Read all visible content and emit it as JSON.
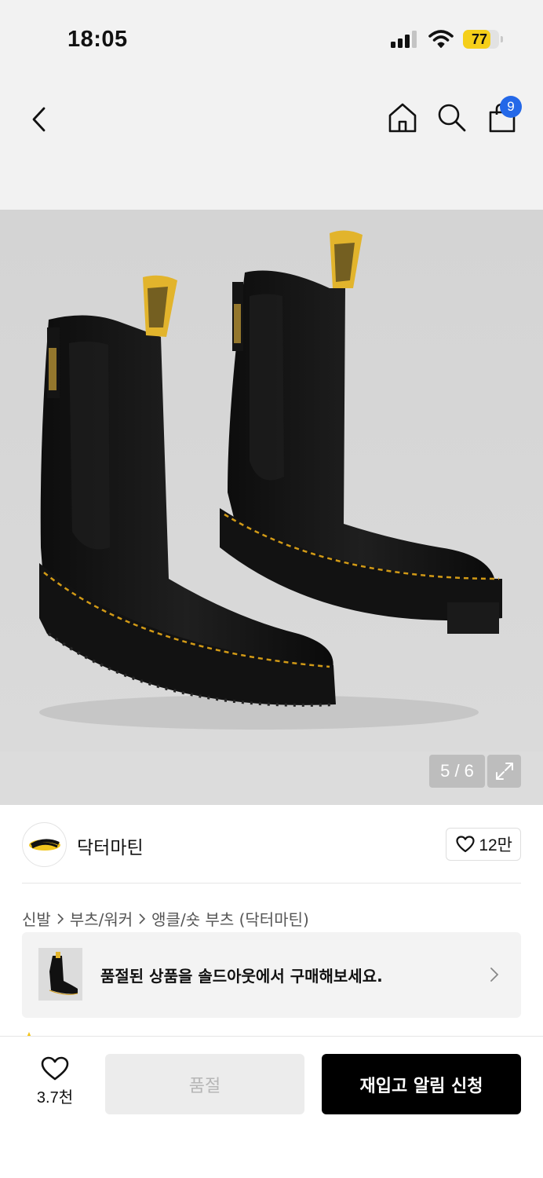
{
  "status_bar": {
    "time": "18:05",
    "battery_percent": "77",
    "battery_level": 0.77
  },
  "nav": {
    "cart_count": "9",
    "icons": [
      "chevron-left-icon",
      "home-icon",
      "search-icon",
      "shopping-bag-icon"
    ]
  },
  "gallery": {
    "page_indicator": "5 / 6",
    "current_index": 5,
    "total": 6,
    "image_subject": "black chelsea boots pair, yellow stitching, pull tabs"
  },
  "brand": {
    "name": "닥터마틴",
    "logo_text": "Dr. Martens",
    "like_count": "12만"
  },
  "breadcrumb": [
    "신발",
    "부츠/워커",
    "앵클/숏 부츠 (닥터마틴)"
  ],
  "soldout_banner": {
    "text": "품절된 상품을 솔드아웃에서 구매해보세요."
  },
  "bottom_bar": {
    "wish_count": "3.7천",
    "soldout_label": "품절",
    "restock_label": "재입고 알림 신청"
  },
  "colors": {
    "accent_blue": "#2468e8",
    "battery_yellow": "#f5cf1a",
    "primary_button": "#000000",
    "disabled_button": "#ececec"
  }
}
